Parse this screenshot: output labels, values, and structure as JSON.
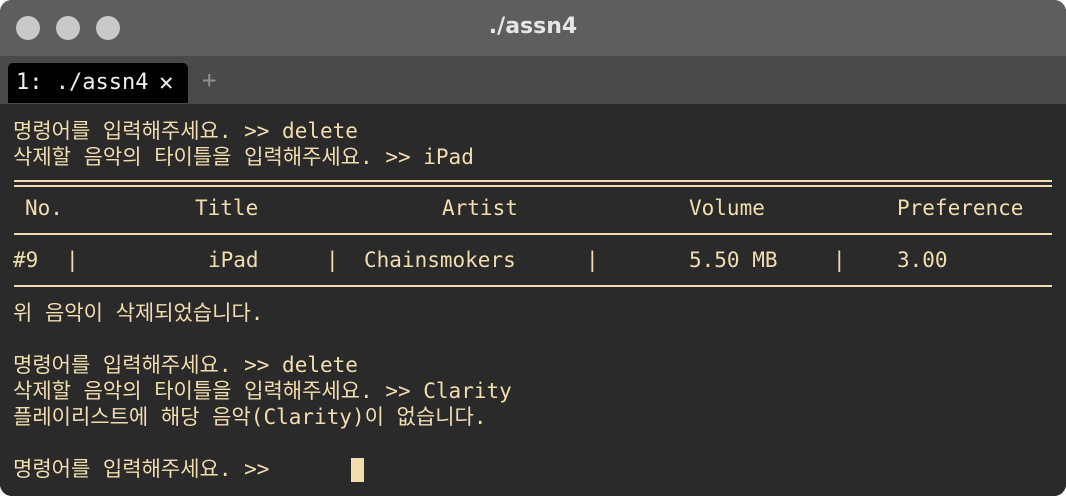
{
  "window": {
    "title": "./assn4"
  },
  "tab": {
    "label": "1: ./assn4",
    "close_glyph": "✕",
    "add_glyph": "+"
  },
  "terminal": {
    "lines_top": [
      "명령어를 입력해주세요. >> delete",
      "삭제할 음악의 타이틀을 입력해주세요. >> iPad"
    ],
    "table": {
      "headers": [
        "No.",
        "Title",
        "Artist",
        "Volume",
        "Preference"
      ],
      "row": {
        "no": "#9",
        "sep": "|",
        "title": "iPad",
        "artist": "Chainsmokers",
        "volume": "5.50 MB",
        "preference": "3.00"
      }
    },
    "lines_bottom": [
      "위 음악이 삭제되었습니다.",
      "",
      "명령어를 입력해주세요. >> delete",
      "삭제할 음악의 타이틀을 입력해주세요. >> Clarity",
      "플레이리스트에 해당 음악(Clarity)이 없습니다.",
      "",
      "명령어를 입력해주세요. >> "
    ]
  },
  "colors": {
    "text": "#f1ddaf",
    "background": "#2a2a2a"
  }
}
